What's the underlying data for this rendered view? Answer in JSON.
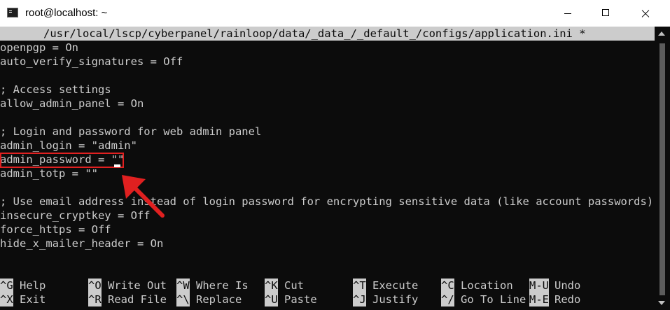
{
  "window": {
    "title": "root@localhost: ~",
    "icon": "terminal-icon",
    "controls": {
      "minimize": "minimize-icon",
      "maximize": "maximize-icon",
      "close": "close-icon"
    }
  },
  "editor": {
    "header": "/usr/local/lscp/cyberpanel/rainloop/data/_data_/_default_/configs/application.ini *",
    "lines": [
      "openpgp = On",
      "auto_verify_signatures = Off",
      "",
      "; Access settings",
      "allow_admin_panel = On",
      "",
      "; Login and password for web admin panel",
      "admin_login = \"admin\"",
      "admin_password = \"\"",
      "admin_totp = \"\"",
      "",
      "; Use email address instead of login password for encrypting sensitive data (like account passwords)",
      "insecure_cryptkey = Off",
      "force_https = Off",
      "hide_x_mailer_header = On"
    ]
  },
  "shortcuts": {
    "row1": [
      {
        "key": "^G",
        "label": "Help"
      },
      {
        "key": "^O",
        "label": "Write Out"
      },
      {
        "key": "^W",
        "label": "Where Is"
      },
      {
        "key": "^K",
        "label": "Cut"
      },
      {
        "key": "^T",
        "label": "Execute"
      },
      {
        "key": "^C",
        "label": "Location"
      },
      {
        "key": "M-U",
        "label": "Undo"
      }
    ],
    "row2": [
      {
        "key": "^X",
        "label": "Exit"
      },
      {
        "key": "^R",
        "label": "Read File"
      },
      {
        "key": "^\\",
        "label": "Replace"
      },
      {
        "key": "^U",
        "label": "Paste"
      },
      {
        "key": "^J",
        "label": "Justify"
      },
      {
        "key": "^/",
        "label": "Go To Line"
      },
      {
        "key": "M-E",
        "label": "Redo"
      }
    ]
  },
  "annotation": {
    "highlight_color": "#e02020"
  }
}
